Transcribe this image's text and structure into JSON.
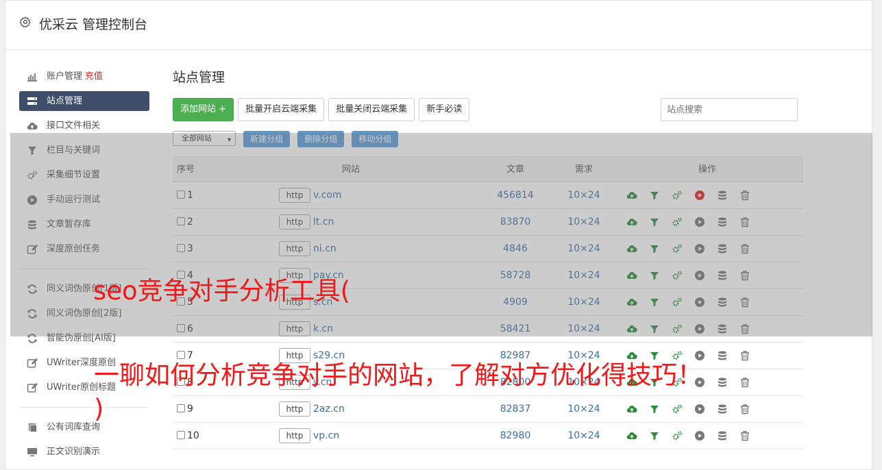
{
  "app": {
    "title": "优采云 管理控制台"
  },
  "sidebar": {
    "group1": [
      {
        "label": "账户管理",
        "extra": "充值",
        "icon": "bar-chart-icon",
        "active": false
      },
      {
        "label": "站点管理",
        "icon": "server-icon",
        "active": true
      },
      {
        "label": "接口文件相关",
        "icon": "cloud-upload-icon",
        "active": false
      },
      {
        "label": "栏目与关键词",
        "icon": "filter-icon",
        "active": false
      },
      {
        "label": "采集细节设置",
        "icon": "cogs-icon",
        "active": false
      },
      {
        "label": "手动运行测试",
        "icon": "play-circle-icon",
        "active": false
      },
      {
        "label": "文章暂存库",
        "icon": "database-icon",
        "active": false
      },
      {
        "label": "深度原创任务",
        "icon": "edit-icon",
        "active": false
      }
    ],
    "group2": [
      {
        "label": "同义词伪原创[1版]",
        "icon": "refresh-icon"
      },
      {
        "label": "同义词伪原创[2版]",
        "icon": "refresh-icon"
      },
      {
        "label": "智能伪原创[AI版]",
        "icon": "refresh-icon"
      },
      {
        "label": "UWriter深度原创",
        "icon": "edit-icon"
      },
      {
        "label": "UWriter原创标题",
        "icon": "edit-icon"
      }
    ],
    "group3": [
      {
        "label": "公有词库查询",
        "icon": "book-icon"
      },
      {
        "label": "正文识别演示",
        "icon": "monitor-icon"
      }
    ]
  },
  "main": {
    "page_title": "站点管理",
    "toolbar": {
      "add_site": "添加网站 +",
      "batch_enable": "批量开启云端采集",
      "batch_disable": "批量关闭云端采集",
      "newbie": "新手必读",
      "search_placeholder": "站点搜索"
    },
    "subbar": {
      "group_select": "全部网站",
      "new_group": "新建分组",
      "delete_group": "删除分组",
      "move_group": "移动分组"
    },
    "table": {
      "headers": {
        "no": "序号",
        "site": "网站",
        "articles": "文章",
        "demand": "需求",
        "ops": "操作"
      },
      "rows": [
        {
          "no": "1",
          "protocol": "http",
          "domain": "v.com",
          "articles": "456814",
          "demand": "10×24",
          "play_active": true
        },
        {
          "no": "2",
          "protocol": "http",
          "domain": "lt.cn",
          "articles": "83870",
          "demand": "10×24",
          "play_active": false
        },
        {
          "no": "3",
          "protocol": "http",
          "domain": "ni.cn",
          "articles": "4846",
          "demand": "10×24",
          "play_active": false
        },
        {
          "no": "4",
          "protocol": "http",
          "domain": "pay.cn",
          "articles": "58728",
          "demand": "10×24",
          "play_active": false
        },
        {
          "no": "5",
          "protocol": "http",
          "domain": "s.cn",
          "articles": "4909",
          "demand": "10×24",
          "play_active": false
        },
        {
          "no": "6",
          "protocol": "http",
          "domain": "k.cn",
          "articles": "58421",
          "demand": "10×24",
          "play_active": false
        },
        {
          "no": "7",
          "protocol": "http",
          "domain": "s29.cn",
          "articles": "82987",
          "demand": "10×24",
          "play_active": false
        },
        {
          "no": "8",
          "protocol": "http",
          "domain": "y.cn",
          "articles": "82800",
          "demand": "10×24",
          "play_active": false
        },
        {
          "no": "9",
          "protocol": "http",
          "domain": "2az.cn",
          "articles": "82837",
          "demand": "10×24",
          "play_active": false
        },
        {
          "no": "10",
          "protocol": "http",
          "domain": "vp.cn",
          "articles": "82980",
          "demand": "10×24",
          "play_active": false
        }
      ]
    }
  },
  "overlay": {
    "line1": "seo竞争对手分析工具(",
    "line2": "一聊如何分析竞争对手的网站，了解对方优化得技巧！",
    "line3": ")"
  },
  "colors": {
    "sidebar_active": "#3e4d6a",
    "primary_green": "#4caf50",
    "link_blue": "#3a6ea5",
    "caption_red": "#f01818",
    "play_active_red": "#e0261c"
  }
}
